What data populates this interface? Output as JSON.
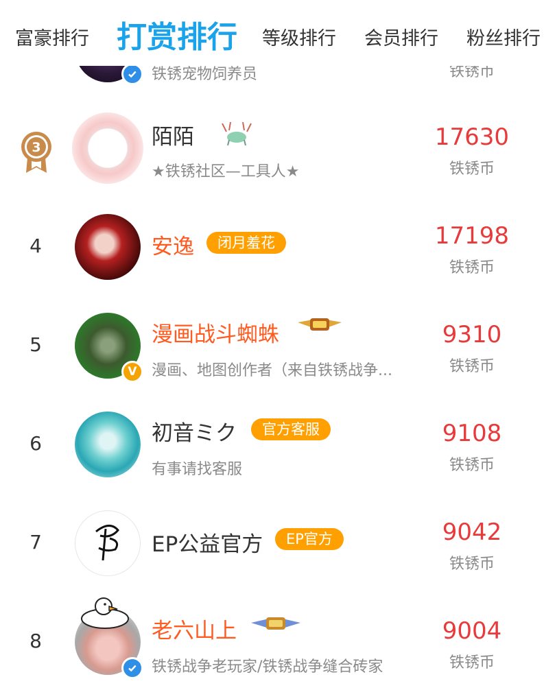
{
  "tabs": [
    {
      "label": "富豪排行",
      "active": false
    },
    {
      "label": "打赏排行",
      "active": true
    },
    {
      "label": "等级排行",
      "active": false
    },
    {
      "label": "会员排行",
      "active": false
    },
    {
      "label": "粉丝排行",
      "active": false
    }
  ],
  "colors": {
    "tab_active": "#1aa3ea",
    "amount": "#e83a3a",
    "name_highlight": "#ff5a1f",
    "badge_bg": "#ff9f00",
    "bronze_medal": "#c98b4c"
  },
  "currency_unit": "铁锈币",
  "rows": [
    {
      "rank": "",
      "name": "",
      "badge": "",
      "desc": "铁锈宠物饲养员",
      "amount": "",
      "unit": "铁锈币",
      "verify": "blue"
    },
    {
      "rank": "3",
      "name": "陌陌",
      "badge": "",
      "desc": "★铁锈社区—工具人★",
      "amount": "17630",
      "unit": "铁锈币",
      "verify": ""
    },
    {
      "rank": "4",
      "name": "安逸",
      "badge": "闭月羞花",
      "desc": "",
      "amount": "17198",
      "unit": "铁锈币",
      "verify": ""
    },
    {
      "rank": "5",
      "name": "漫画战斗蜘蛛",
      "badge": "",
      "desc": "漫画、地图创作者（来自铁锈战争...",
      "amount": "9310",
      "unit": "铁锈币",
      "verify": "gold"
    },
    {
      "rank": "6",
      "name": "初音ミク",
      "badge": "官方客服",
      "desc": "有事请找客服",
      "amount": "9108",
      "unit": "铁锈币",
      "verify": ""
    },
    {
      "rank": "7",
      "name": "EP公益官方",
      "badge": "EP官方",
      "desc": "",
      "amount": "9042",
      "unit": "铁锈币",
      "verify": ""
    },
    {
      "rank": "8",
      "name": "老六山上",
      "badge": "",
      "desc": "铁锈战争老玩家/铁锈战争缝合砖家",
      "amount": "9004",
      "unit": "铁锈币",
      "verify": "blue"
    }
  ],
  "verify_gold_letter": "V"
}
